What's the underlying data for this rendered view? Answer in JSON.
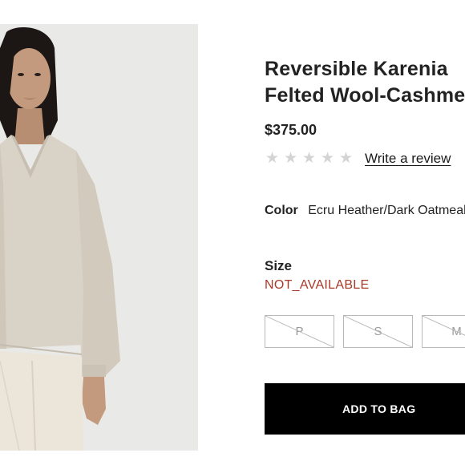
{
  "product": {
    "title_line1": "Reversible Karenia",
    "title_line2": "Felted Wool-Cashmere",
    "price": "$375.00",
    "rating": {
      "stars": 0,
      "max_stars": 5,
      "empty_star_glyph": "★"
    },
    "review_link": "Write a review",
    "color": {
      "label": "Color",
      "value": "Ecru Heather/Dark Oatmeal"
    },
    "size": {
      "label": "Size",
      "status": "NOT_AVAILABLE",
      "options": [
        {
          "label": "P",
          "available": false
        },
        {
          "label": "S",
          "available": false
        },
        {
          "label": "M",
          "available": false
        }
      ]
    },
    "add_to_bag_label": "ADD TO BAG"
  },
  "colors": {
    "status_unavailable": "#a83a2a",
    "button_bg": "#000000",
    "star_empty": "#d4d4d4",
    "sweater": "#d9d2c6",
    "photo_bg": "#e9e9e7"
  },
  "image": {
    "icon": "product-photo-icon",
    "subject": "model wearing v-neck sweater"
  }
}
